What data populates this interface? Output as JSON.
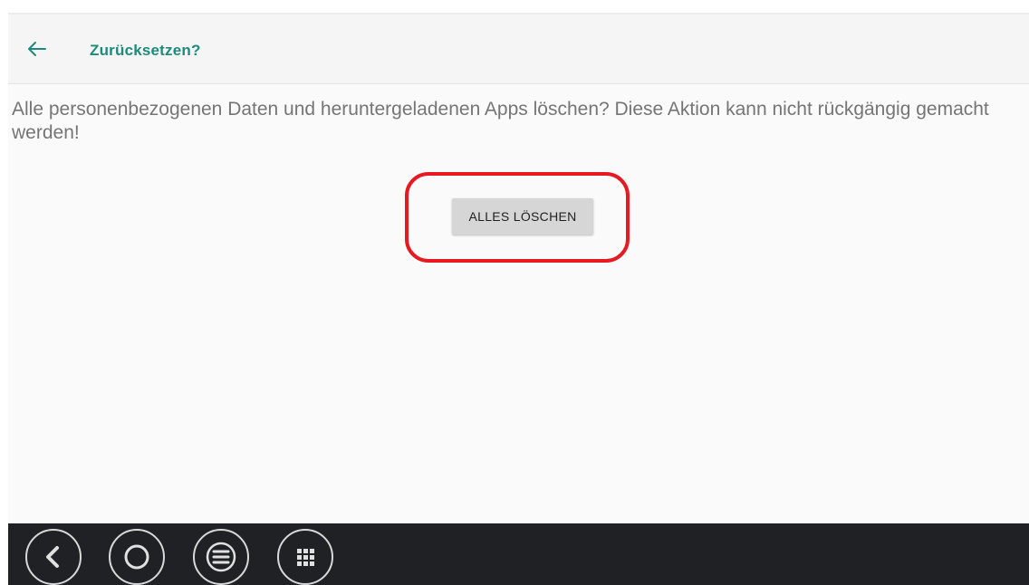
{
  "app_bar": {
    "title": "Zurücksetzen?",
    "back_icon": "arrow-left-icon",
    "accent_color": "#1e8a7b"
  },
  "content": {
    "description": "Alle personenbezogenen Daten und heruntergeladenen Apps löschen? Diese Aktion kann nicht rückgängig gemacht werden!",
    "erase_button_label": "ALLES LÖSCHEN",
    "highlight_color": "#e51a23"
  },
  "nav_bar": {
    "buttons": [
      {
        "name": "back",
        "icon": "chevron-left-icon"
      },
      {
        "name": "home",
        "icon": "circle-home-icon"
      },
      {
        "name": "menu",
        "icon": "hamburger-menu-icon"
      },
      {
        "name": "apps",
        "icon": "app-grid-icon"
      }
    ]
  }
}
